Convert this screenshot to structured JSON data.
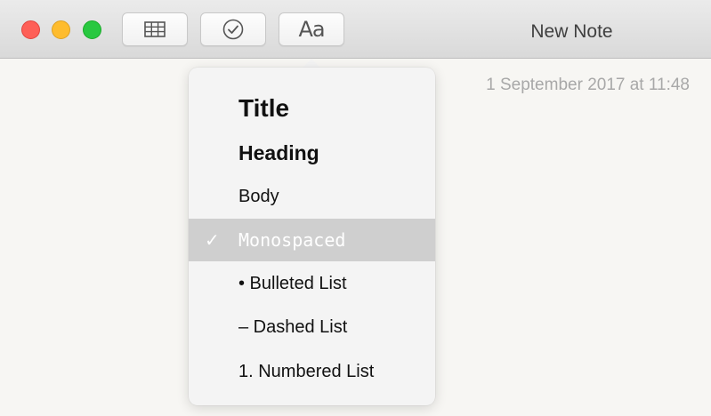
{
  "window": {
    "title": "New Note"
  },
  "toolbar": {
    "buttons": [
      {
        "name": "table",
        "icon": "table-icon"
      },
      {
        "name": "checklist",
        "icon": "checkmark-circle-icon"
      },
      {
        "name": "format",
        "label": "Aa"
      }
    ]
  },
  "note": {
    "date": "1 September 2017 at 11:48"
  },
  "format_menu": {
    "items": [
      {
        "label": "Title",
        "selected": false
      },
      {
        "label": "Heading",
        "selected": false
      },
      {
        "label": "Body",
        "selected": false
      },
      {
        "label": "Monospaced",
        "selected": true
      },
      {
        "label": "• Bulleted List",
        "selected": false
      },
      {
        "label": "– Dashed List",
        "selected": false
      },
      {
        "label": "1. Numbered List",
        "selected": false
      }
    ],
    "check_glyph": "✓"
  },
  "colors": {
    "close": "#fe5f57",
    "minimize": "#febc2e",
    "zoom": "#28c840",
    "selected_row": "#cfcfcf"
  }
}
